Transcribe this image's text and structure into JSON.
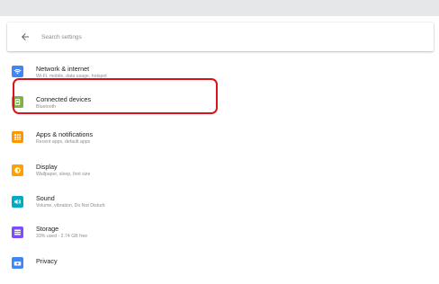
{
  "search": {
    "placeholder": "Search settings",
    "back_icon": "arrow-left-icon"
  },
  "settings": [
    {
      "title": "Network & internet",
      "subtitle": "Wi-Fi, mobile, data usage, hotspot",
      "icon": "wifi-icon",
      "color": "#4285f4"
    },
    {
      "title": "Connected devices",
      "subtitle": "Bluetooth",
      "icon": "devices-icon",
      "color": "#7cb342"
    },
    {
      "title": "Apps & notifications",
      "subtitle": "Recent apps, default apps",
      "icon": "apps-icon",
      "color": "#ff9800"
    },
    {
      "title": "Display",
      "subtitle": "Wallpaper, sleep, font size",
      "icon": "brightness-icon",
      "color": "#ffa000"
    },
    {
      "title": "Sound",
      "subtitle": "Volume, vibration, Do Not Disturb",
      "icon": "volume-icon",
      "color": "#00acc1"
    },
    {
      "title": "Storage",
      "subtitle": "33% used - 2.74 GB free",
      "icon": "storage-icon",
      "color": "#7c4dff"
    },
    {
      "title": "Privacy",
      "subtitle": "",
      "icon": "privacy-icon",
      "color": "#4285f4"
    }
  ],
  "highlight_color": "#d7141a"
}
